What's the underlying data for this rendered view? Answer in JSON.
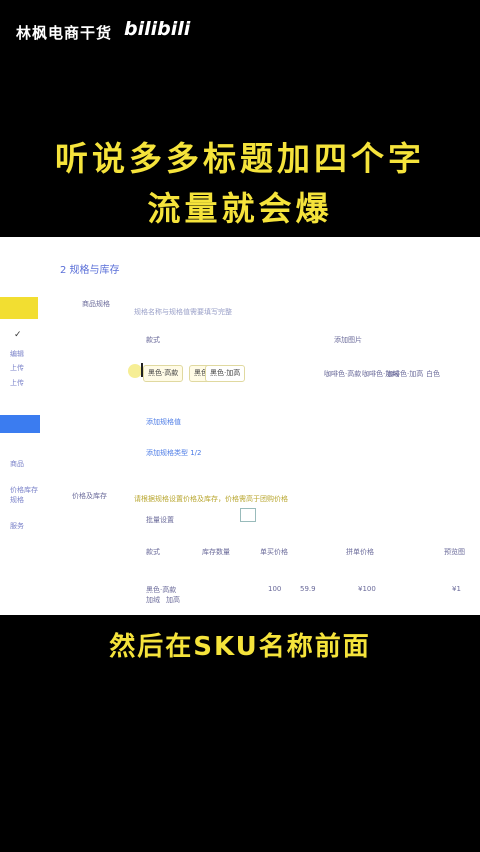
{
  "overlay": {
    "channel_name": "林枫电商干货",
    "platform_logo": "bilibili",
    "headline_line1": "听说多多标题加四个字",
    "headline_line2": "流量就会爆",
    "caption": "然后在SKU名称前面"
  },
  "screenshot": {
    "section_title": "2  规格与库存",
    "sidebar": [
      "编辑",
      "上传",
      "上传"
    ],
    "sidebar_lower": [
      "商品",
      "价格库存",
      "规格",
      "服务"
    ],
    "spec_label": "商品规格",
    "spec_hint": "规格名称与规格值需要填写完整",
    "spec_name_header": "款式",
    "spec_value_header": "添加图片",
    "spec_chips": [
      "黑色·高款",
      "黑色·加绒",
      "黑色·加高"
    ],
    "spec_chips_right": [
      "咖啡色·高款",
      "咖啡色·加绒",
      "咖啡色·加高",
      "白色"
    ],
    "add_spec_value_link": "添加规格值",
    "add_spec_link": "添加规格类型 1/2",
    "price_label": "价格及库存",
    "price_hint": "请根据规格设置价格及库存，价格需高于团购价格",
    "batch_label": "批量设置",
    "table_headers": [
      "款式",
      "库存数量",
      "单买价格",
      "拼单价格",
      "预览图"
    ],
    "row_sku": "黑色·高款",
    "row_sku_extra": [
      "加绒",
      "加高"
    ],
    "row_values": [
      "100",
      "59.9",
      "¥100",
      "¥1"
    ]
  }
}
